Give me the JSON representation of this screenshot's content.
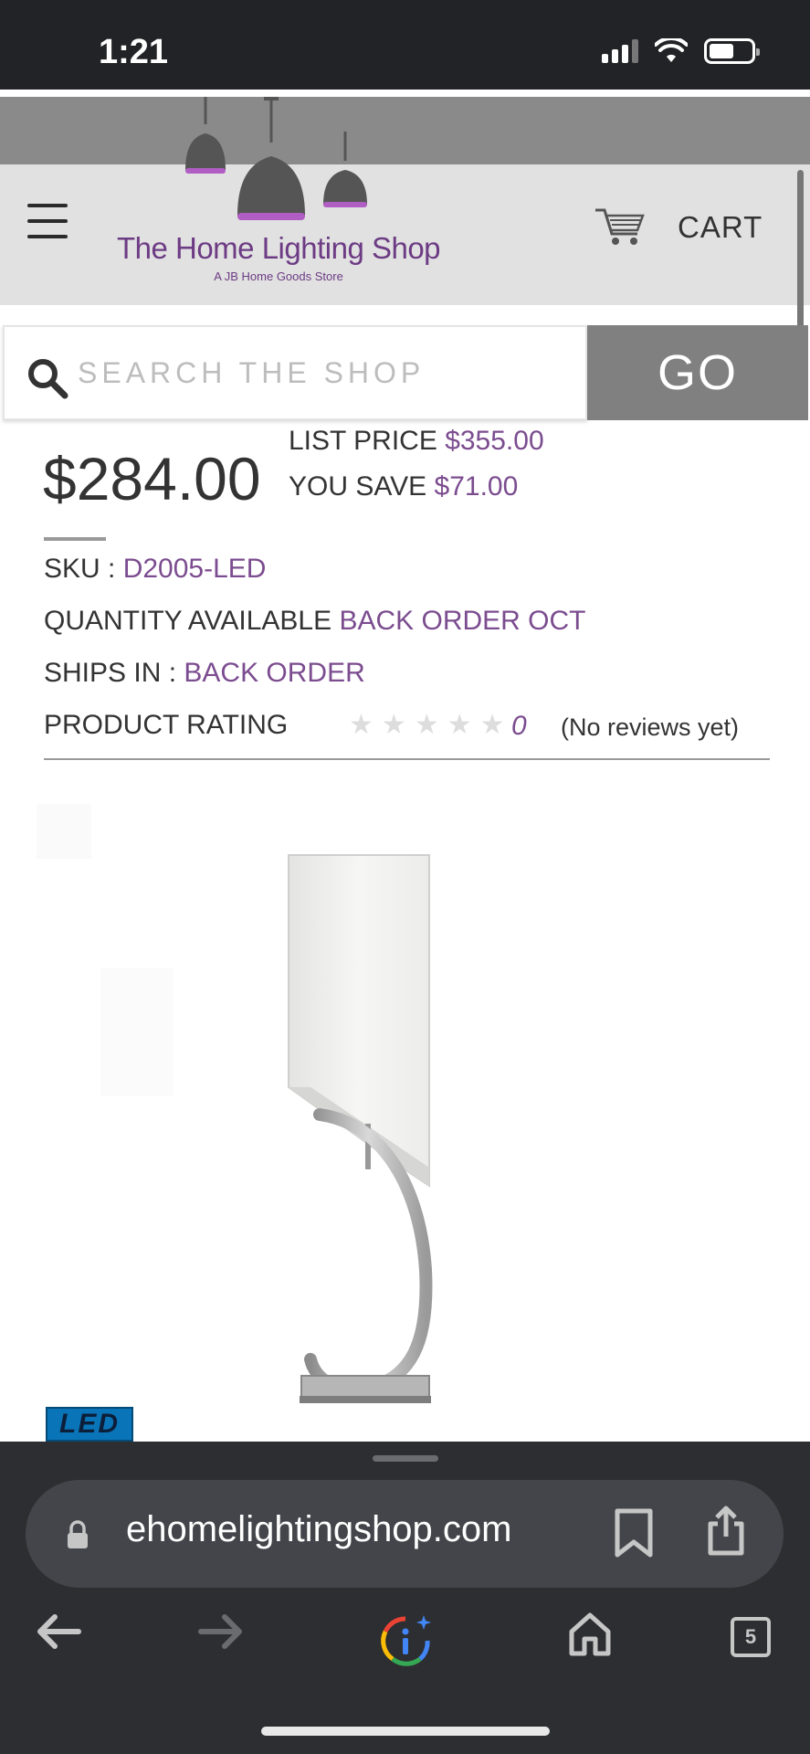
{
  "status_bar": {
    "time": "1:21"
  },
  "header": {
    "logo_title": "The Home Lighting Shop",
    "logo_subtitle": "A JB Home Goods Store",
    "cart_label": "CART"
  },
  "search": {
    "placeholder": "SEARCH THE SHOP",
    "go_label": "GO"
  },
  "product": {
    "price": "$284.00",
    "list_price_label": "LIST PRICE",
    "list_price_value": "$355.00",
    "you_save_label": "YOU SAVE",
    "you_save_value": "$71.00",
    "sku_label": "SKU :",
    "sku_value": "D2005-LED",
    "quantity_label": "QUANTITY AVAILABLE",
    "quantity_value": "BACK ORDER OCT",
    "ships_label": "SHIPS IN :",
    "ships_value": "BACK ORDER",
    "rating_label": "PRODUCT RATING",
    "rating_value": "0",
    "rating_max": 5,
    "reviews_text": "(No reviews yet)",
    "badge": "LED"
  },
  "browser": {
    "url": "ehomelightingshop.com",
    "tab_count": "5"
  },
  "colors": {
    "accent_purple": "#7b4c8f",
    "header_bg": "#e1e1e1",
    "go_button": "#808080",
    "browser_bg": "#2d2e31"
  }
}
